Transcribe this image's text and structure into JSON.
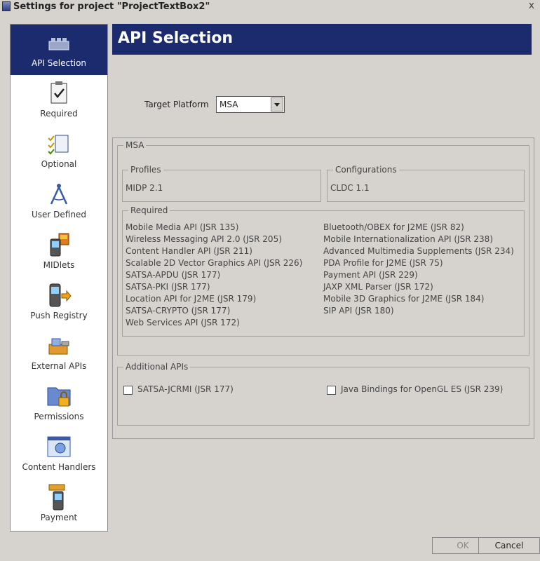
{
  "window": {
    "title": "Settings for project \"ProjectTextBox2\"",
    "close_glyph": "x"
  },
  "sidebar": {
    "items": [
      {
        "label": "API Selection",
        "icon": "bricks-icon",
        "selected": true
      },
      {
        "label": "Required",
        "icon": "clipboard-check-icon",
        "selected": false
      },
      {
        "label": "Optional",
        "icon": "checklist-icon",
        "selected": false
      },
      {
        "label": "User Defined",
        "icon": "compass-icon",
        "selected": false
      },
      {
        "label": "MIDlets",
        "icon": "phone-midlet-icon",
        "selected": false
      },
      {
        "label": "Push Registry",
        "icon": "phone-push-icon",
        "selected": false
      },
      {
        "label": "External APIs",
        "icon": "package-icon",
        "selected": false
      },
      {
        "label": "Permissions",
        "icon": "folder-lock-icon",
        "selected": false
      },
      {
        "label": "Content Handlers",
        "icon": "content-handler-icon",
        "selected": false
      },
      {
        "label": "Payment",
        "icon": "phone-payment-icon",
        "selected": false
      }
    ]
  },
  "header": {
    "title": "API Selection"
  },
  "target_platform": {
    "label": "Target Platform",
    "value": "MSA"
  },
  "msa": {
    "legend": "MSA",
    "profiles": {
      "legend": "Profiles",
      "value": "MIDP 2.1"
    },
    "configurations": {
      "legend": "Configurations",
      "value": "CLDC 1.1"
    },
    "required": {
      "legend": "Required",
      "left": [
        "Mobile Media API (JSR 135)",
        "Wireless Messaging API 2.0 (JSR 205)",
        "Content Handler API (JSR 211)",
        "Scalable 2D Vector Graphics API (JSR 226)",
        "SATSA-APDU (JSR 177)",
        "SATSA-PKI (JSR 177)",
        "Location API for J2ME (JSR 179)",
        "SATSA-CRYPTO (JSR 177)",
        "Web Services API (JSR 172)"
      ],
      "right": [
        "Bluetooth/OBEX for J2ME (JSR 82)",
        "Mobile Internationalization API (JSR 238)",
        "Advanced Multimedia Supplements (JSR 234)",
        "PDA Profile for J2ME (JSR 75)",
        "Payment API (JSR 229)",
        "JAXP XML Parser (JSR 172)",
        "Mobile 3D Graphics for J2ME (JSR 184)",
        "SIP API (JSR 180)"
      ]
    }
  },
  "additional": {
    "legend": "Additional APIs",
    "items": [
      {
        "label": "SATSA-JCRMI (JSR 177)",
        "checked": false
      },
      {
        "label": "Java Bindings for OpenGL ES (JSR 239)",
        "checked": false
      }
    ]
  },
  "buttons": {
    "ok": "OK",
    "cancel": "Cancel"
  }
}
